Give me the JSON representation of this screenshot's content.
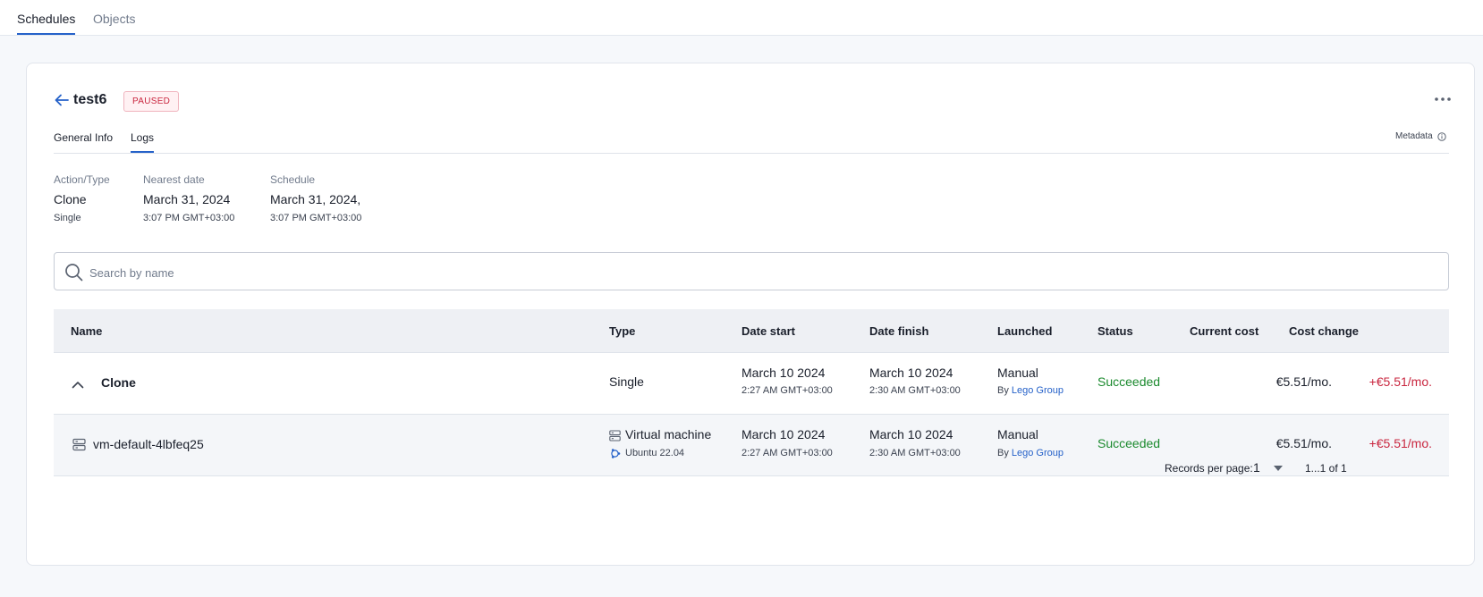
{
  "top_tabs": [
    {
      "label": "Schedules",
      "active": true
    },
    {
      "label": "Objects",
      "active": false
    }
  ],
  "header": {
    "title": "test6",
    "status_badge": "PAUSED",
    "icons": {
      "back": "arrow-left-icon",
      "more": "more-horizontal-icon"
    }
  },
  "sub_tabs": [
    {
      "label": "General Info",
      "active": false
    },
    {
      "label": "Logs",
      "active": true
    }
  ],
  "metadata": {
    "label": "Metadata",
    "icon": "info-icon"
  },
  "info": {
    "action_type": {
      "label": "Action/Type",
      "value": "Clone",
      "sub": "Single"
    },
    "nearest_date": {
      "label": "Nearest date",
      "value": "March 31, 2024",
      "sub": "3:07 PM GMT+03:00"
    },
    "schedule": {
      "label": "Schedule",
      "value": "March 31, 2024,",
      "sub": "3:07 PM GMT+03:00"
    }
  },
  "search": {
    "placeholder": "Search by name",
    "value": "",
    "icon": "search-icon"
  },
  "table": {
    "columns": [
      "Name",
      "Type",
      "Date start",
      "Date finish",
      "Launched",
      "Status",
      "Current cost",
      "Cost change"
    ],
    "rows": [
      {
        "name": "Clone",
        "type": "Single",
        "type_sub": "",
        "date_start": "March 10 2024",
        "date_start_time": "2:27 AM GMT+03:00",
        "date_finish": "March 10 2024",
        "date_finish_time": "2:30 AM GMT+03:00",
        "launched": "Manual",
        "launched_by_prefix": "By",
        "launched_by": "Lego Group",
        "status": "Succeeded",
        "current_cost": "€5.51/mo.",
        "cost_change": "+€5.51/mo.",
        "icon": "chevron-up-icon"
      },
      {
        "name": "vm-default-4lbfeq25",
        "type": "Virtual machine",
        "type_sub": "Ubuntu 22.04",
        "date_start": "March 10 2024",
        "date_start_time": "2:27 AM GMT+03:00",
        "date_finish": "March 10 2024",
        "date_finish_time": "2:30 AM GMT+03:00",
        "launched": "Manual",
        "launched_by_prefix": "By",
        "launched_by": "Lego Group",
        "status": "Succeeded",
        "current_cost": "€5.51/mo.",
        "cost_change": "+€5.51/mo.",
        "icon": "server-icon",
        "type_icon": "server-icon",
        "os_icon": "ubuntu-icon"
      }
    ]
  },
  "pagination": {
    "records_label": "Records per page:",
    "records_value": "1",
    "range": "1...1 of 1"
  },
  "colors": {
    "accent": "#2662c9",
    "success": "#1b8a2e",
    "danger": "#c9263f",
    "badge_bg": "#fff1f3"
  }
}
